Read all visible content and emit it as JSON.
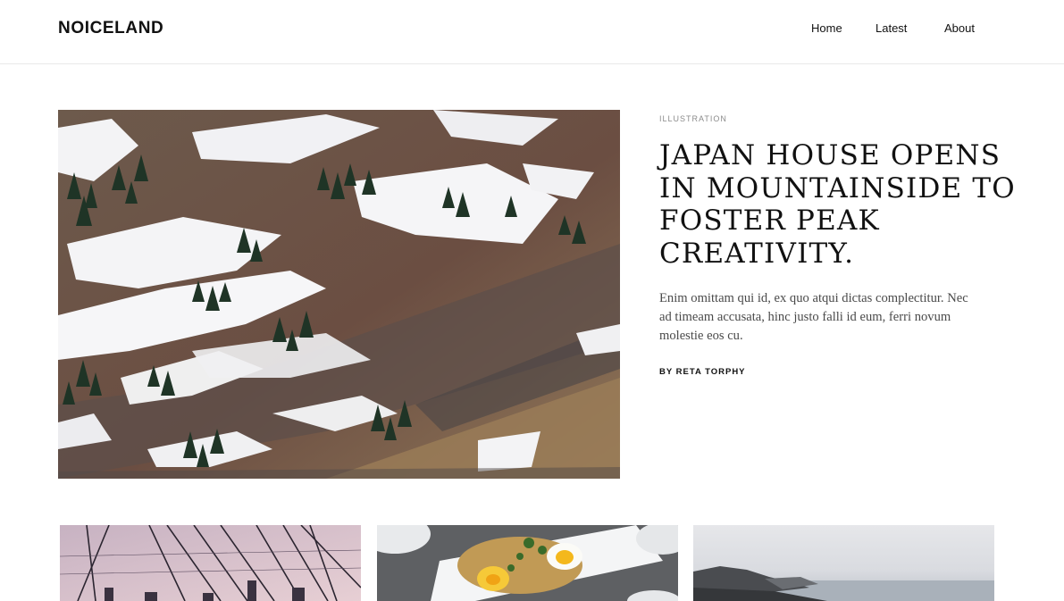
{
  "site": {
    "brand": "NOICELAND",
    "nav": [
      {
        "label": "Home"
      },
      {
        "label": "Latest"
      },
      {
        "label": "About"
      }
    ]
  },
  "featured": {
    "category": "ILLUSTRATION",
    "title": "JAPAN HOUSE OPENS IN MOUNTAINSIDE TO FOSTER PEAK CREATIVITY.",
    "excerpt": "Enim omittam qui id, ex quo atqui dictas complectitur. Nec ad timeam accusata, hinc justo falli id eum, ferri novum molestie eos cu.",
    "byline": "BY RETA TORPHY",
    "image": "snowy-mountain-photo"
  },
  "cards": [
    {
      "image": "bridge-cables-photo"
    },
    {
      "image": "food-plate-photo"
    },
    {
      "image": "coastal-mountains-photo"
    }
  ]
}
